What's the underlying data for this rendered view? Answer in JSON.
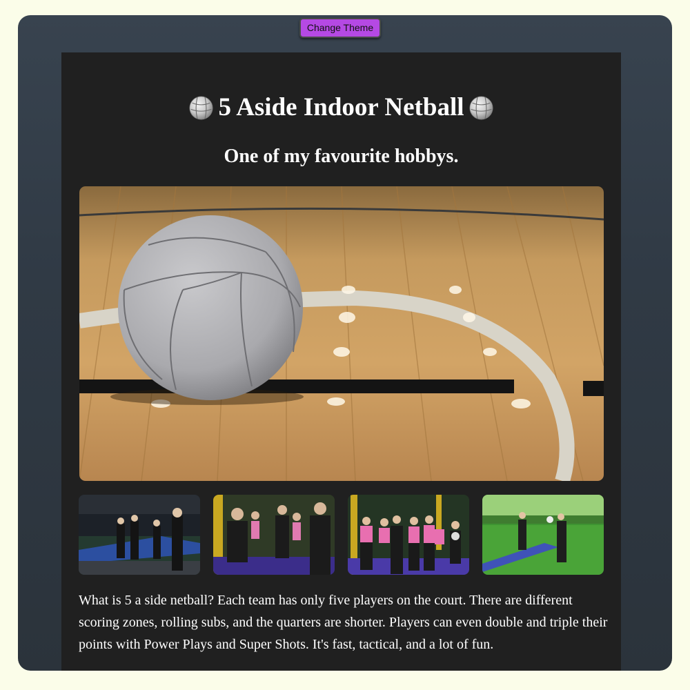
{
  "toolbar": {
    "change_theme_label": "Change Theme"
  },
  "page": {
    "title": "5 Aside Indoor Netball",
    "subtitle": "One of my favourite hobbys.",
    "hero_image": "netball-on-court-photo",
    "thumbnails": [
      "players-indoor-arena-photo",
      "players-pink-bibs-group-photo",
      "team-pink-bibs-celebration-photo",
      "players-green-court-action-photo"
    ],
    "description": "What is 5 a side netball? Each team has only five players on the court. There are different scoring zones, rolling subs, and the quarters are shorter. Players can even double and triple their points with Power Plays and Super Shots. It's fast, tactical, and a lot of fun."
  },
  "colors": {
    "page_background": "#fbfde9",
    "frame_background": "#333d47",
    "card_background": "#202020",
    "button_background": "#b549e4",
    "text": "#ffffff"
  }
}
